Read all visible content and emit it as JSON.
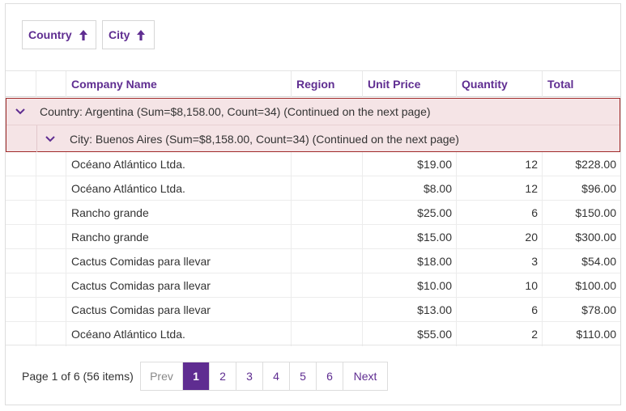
{
  "group_panel": {
    "chips": [
      {
        "label": "Country",
        "sort": "ascending"
      },
      {
        "label": "City",
        "sort": "ascending"
      }
    ]
  },
  "columns": [
    "Company Name",
    "Region",
    "Unit Price",
    "Quantity",
    "Total"
  ],
  "groups": {
    "level1": "Country: Argentina (Sum=$8,158.00, Count=34) (Continued on the next page)",
    "level2": "City: Buenos Aires (Sum=$8,158.00, Count=34) (Continued on the next page)"
  },
  "rows": [
    {
      "company": "Océano Atlántico Ltda.",
      "region": "",
      "unit_price": "$19.00",
      "quantity": "12",
      "total": "$228.00"
    },
    {
      "company": "Océano Atlántico Ltda.",
      "region": "",
      "unit_price": "$8.00",
      "quantity": "12",
      "total": "$96.00"
    },
    {
      "company": "Rancho grande",
      "region": "",
      "unit_price": "$25.00",
      "quantity": "6",
      "total": "$150.00"
    },
    {
      "company": "Rancho grande",
      "region": "",
      "unit_price": "$15.00",
      "quantity": "20",
      "total": "$300.00"
    },
    {
      "company": "Cactus Comidas para llevar",
      "region": "",
      "unit_price": "$18.00",
      "quantity": "3",
      "total": "$54.00"
    },
    {
      "company": "Cactus Comidas para llevar",
      "region": "",
      "unit_price": "$10.00",
      "quantity": "10",
      "total": "$100.00"
    },
    {
      "company": "Cactus Comidas para llevar",
      "region": "",
      "unit_price": "$13.00",
      "quantity": "6",
      "total": "$78.00"
    },
    {
      "company": "Océano Atlántico Ltda.",
      "region": "",
      "unit_price": "$55.00",
      "quantity": "2",
      "total": "$110.00"
    }
  ],
  "pager": {
    "info": "Page 1 of 6 (56 items)",
    "prev_label": "Prev",
    "next_label": "Next",
    "pages": [
      "1",
      "2",
      "3",
      "4",
      "5",
      "6"
    ],
    "current_page": "1"
  },
  "colors": {
    "accent": "#5f2d91",
    "group_background": "#f5e4e6",
    "group_border": "#a02a2a"
  },
  "icons": {
    "sort_ascending": "arrow-up-icon",
    "group_expanded": "chevron-down-icon"
  }
}
